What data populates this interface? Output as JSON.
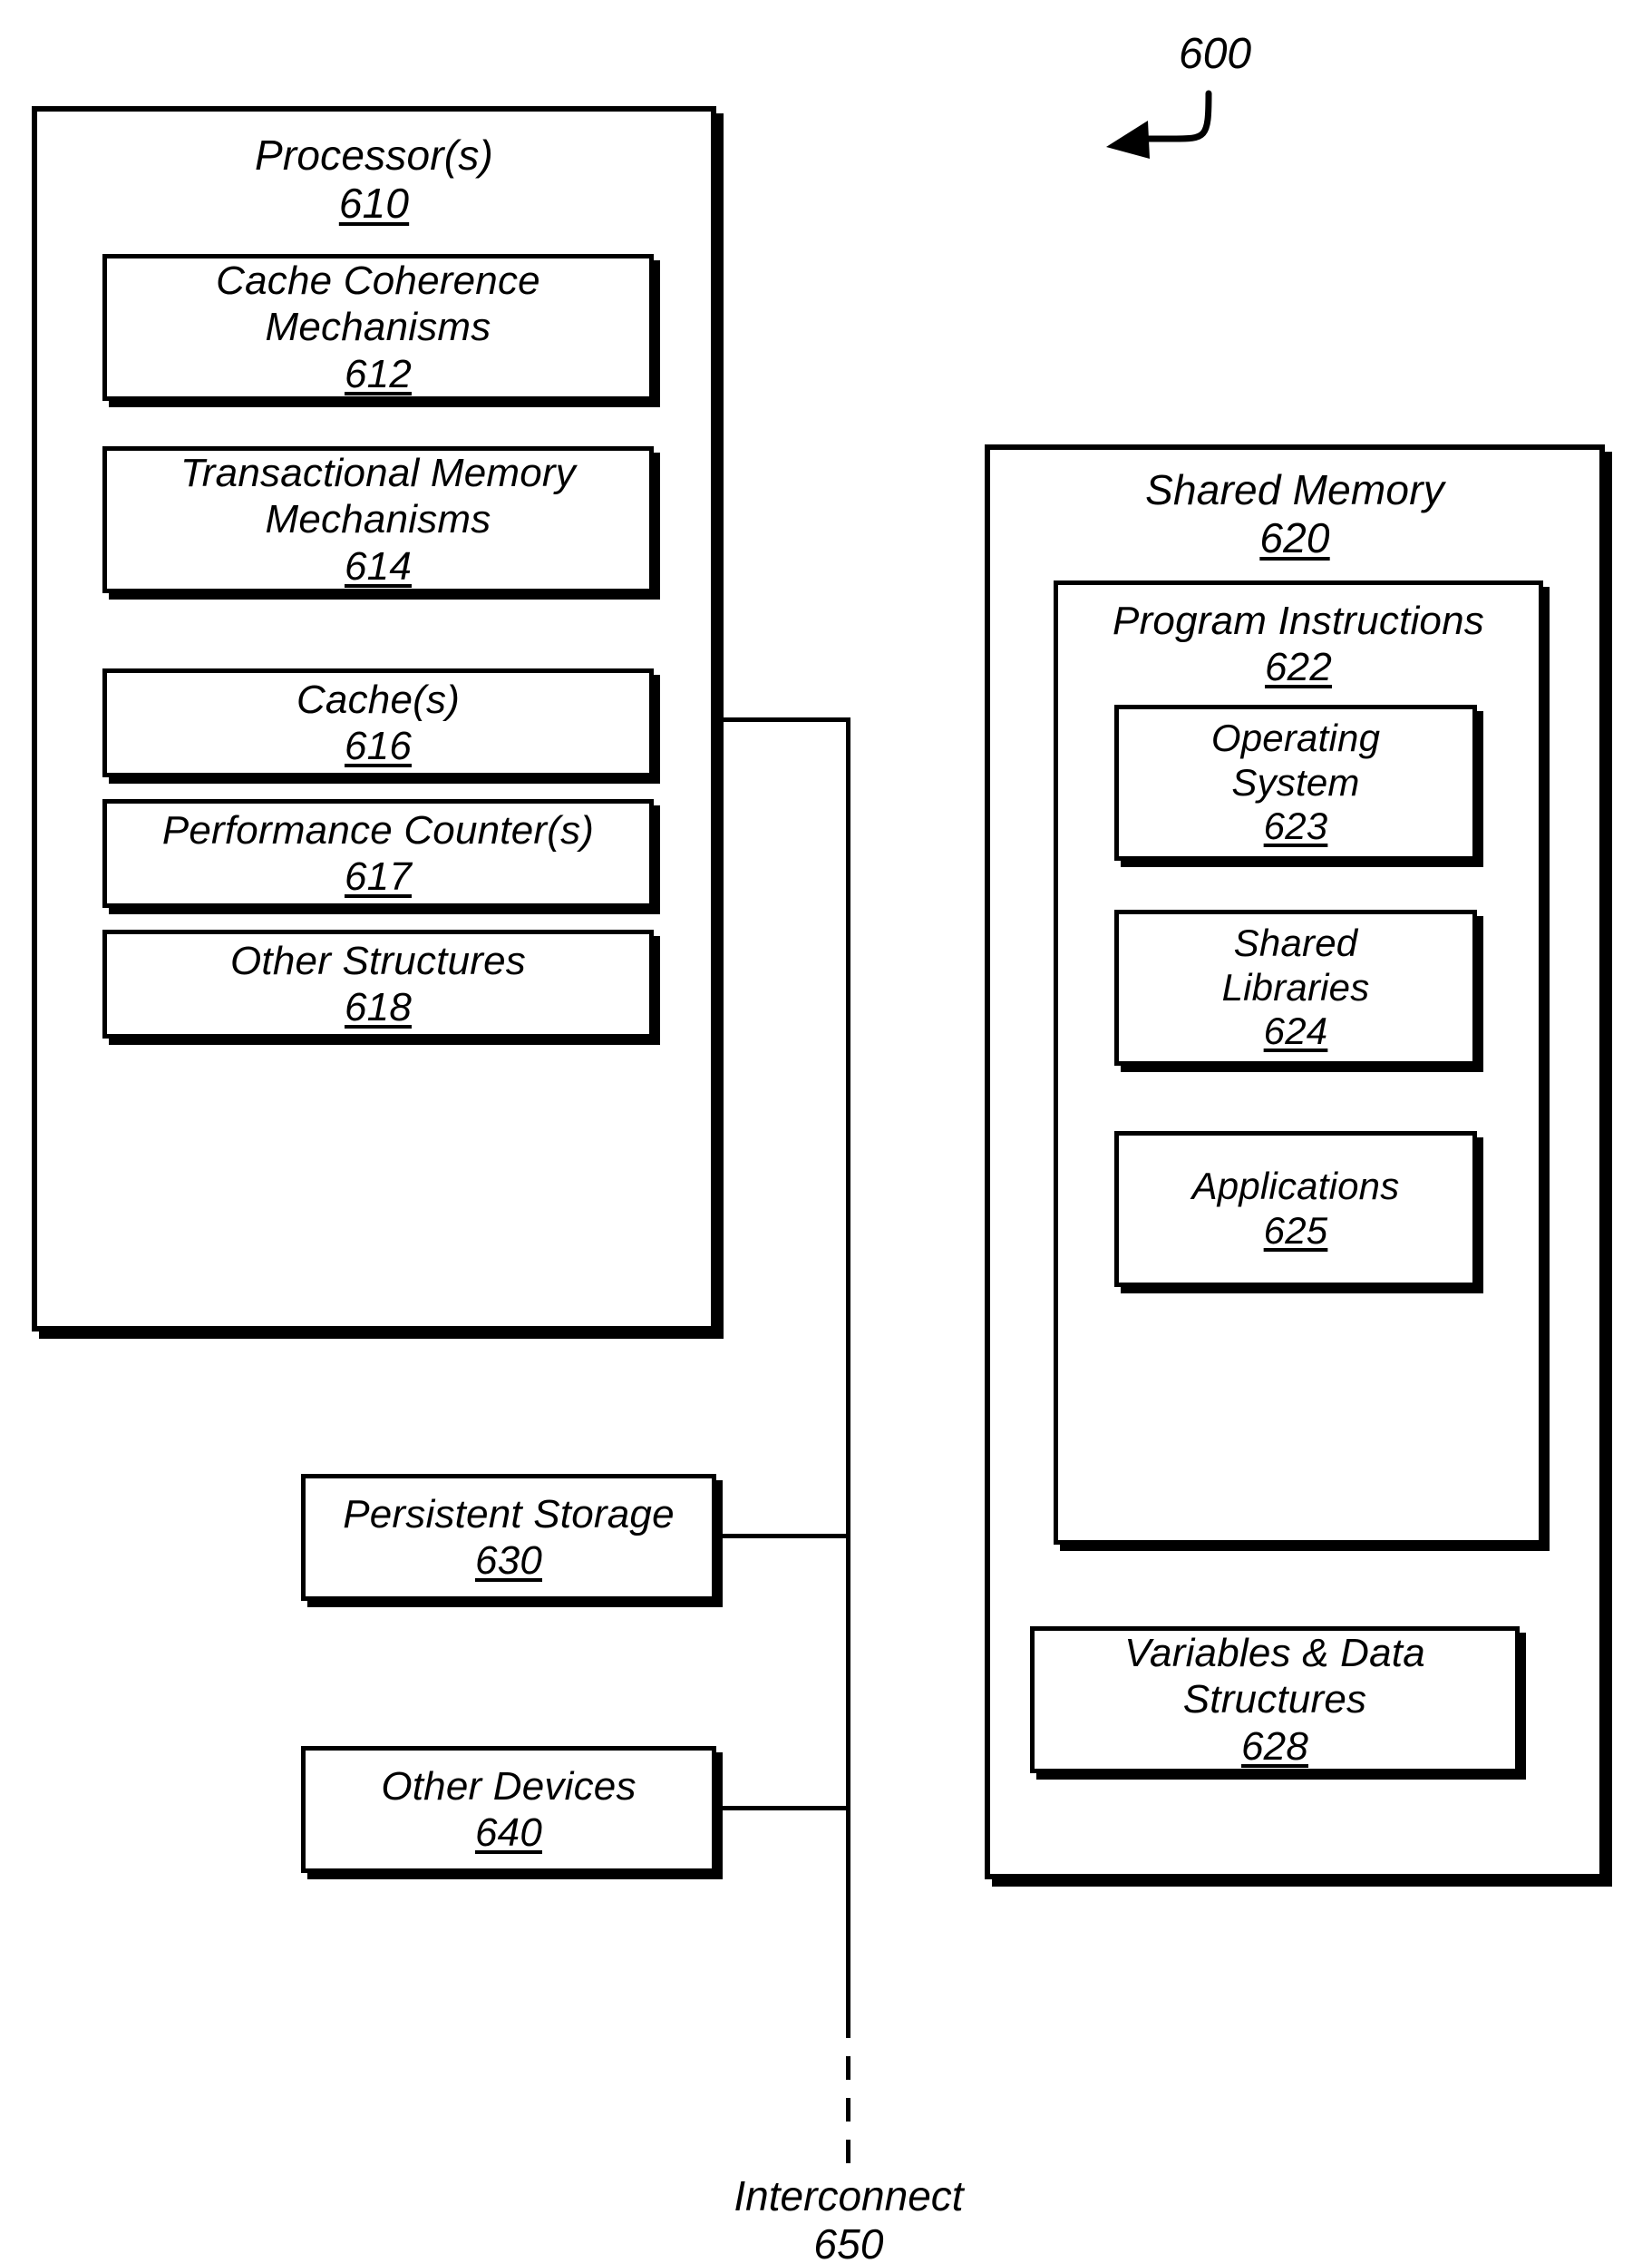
{
  "figure": {
    "callout_number": "600",
    "callout_icon": "curved-arrow-icon"
  },
  "processor": {
    "title": "Processor(s)",
    "ref": "610",
    "children": [
      {
        "title": "Cache Coherence\nMechanisms",
        "ref": "612"
      },
      {
        "title": "Transactional Memory\nMechanisms",
        "ref": "614"
      },
      {
        "title": "Cache(s)",
        "ref": "616"
      },
      {
        "title": "Performance Counter(s)",
        "ref": "617"
      },
      {
        "title": "Other Structures",
        "ref": "618"
      }
    ]
  },
  "shared_memory": {
    "title": "Shared Memory",
    "ref": "620",
    "program_instructions": {
      "title": "Program Instructions",
      "ref": "622",
      "children": [
        {
          "title": "Operating\nSystem",
          "ref": "623"
        },
        {
          "title": "Shared\nLibraries",
          "ref": "624"
        },
        {
          "title": "Applications",
          "ref": "625"
        }
      ]
    },
    "variables": {
      "title": "Variables & Data\nStructures",
      "ref": "628"
    }
  },
  "persistent_storage": {
    "title": "Persistent Storage",
    "ref": "630"
  },
  "other_devices": {
    "title": "Other Devices",
    "ref": "640"
  },
  "interconnect": {
    "title": "Interconnect",
    "ref": "650"
  }
}
